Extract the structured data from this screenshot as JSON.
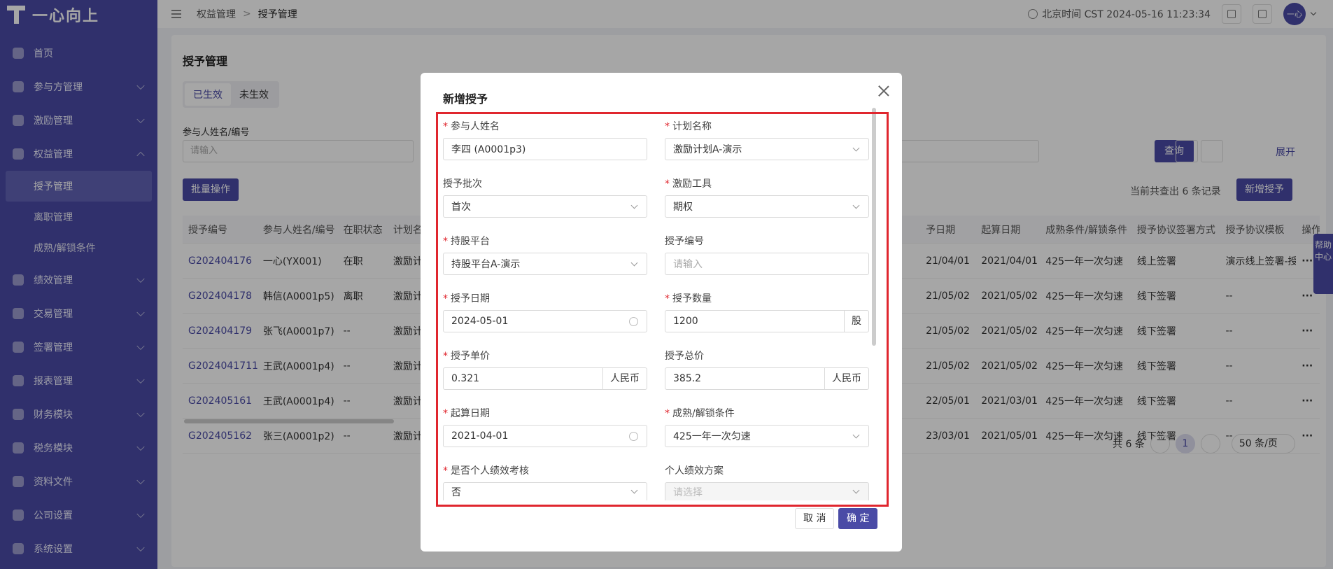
{
  "app": {
    "logo_text": "一心向上"
  },
  "sidebar": {
    "items": [
      {
        "label": "首页",
        "expandable": false
      },
      {
        "label": "参与方管理",
        "expandable": true
      },
      {
        "label": "激励管理",
        "expandable": true
      },
      {
        "label": "权益管理",
        "expandable": true,
        "expanded": true,
        "children": [
          "授予管理",
          "离职管理",
          "成熟/解锁条件"
        ]
      },
      {
        "label": "绩效管理",
        "expandable": true
      },
      {
        "label": "交易管理",
        "expandable": true
      },
      {
        "label": "签署管理",
        "expandable": true
      },
      {
        "label": "报表管理",
        "expandable": true
      },
      {
        "label": "财务模块",
        "expandable": true
      },
      {
        "label": "税务模块",
        "expandable": true
      },
      {
        "label": "资料文件",
        "expandable": true
      },
      {
        "label": "公司设置",
        "expandable": true
      },
      {
        "label": "系统设置",
        "expandable": true
      }
    ],
    "active_child": "授予管理"
  },
  "topbar": {
    "breadcrumb": [
      "权益管理",
      "授予管理"
    ],
    "clock": "北京时间 CST 2024-05-16 11:23:34",
    "avatar": "一心"
  },
  "page": {
    "title": "授予管理",
    "tabs": [
      "已生效",
      "未生效"
    ],
    "filter_label": "参与人姓名/编号",
    "filter_placeholder": "请输入",
    "query_label": "查询",
    "expand_label": "展开",
    "batch_label": "批量操作",
    "count_text": "当前共查出 6 条记录",
    "add_label": "新增授予",
    "table": {
      "headers": [
        "授予编号",
        "参与人姓名/编号",
        "在职状态",
        "计划名",
        "",
        "",
        "",
        "",
        "",
        "",
        "予日期",
        "起算日期",
        "成熟条件/解锁条件",
        "授予协议签署方式",
        "授予协议模板",
        "操作"
      ],
      "rows": [
        [
          "G202404176",
          "一心(YX001)",
          "在职",
          "激励计",
          "21/04/01",
          "2021/04/01",
          "425一年一次匀速",
          "线上签署",
          "演示线上签署-授予"
        ],
        [
          "G202404178",
          "韩信(A0001p5)",
          "离职",
          "激励计",
          "21/05/02",
          "2021/05/02",
          "425一年一次匀速",
          "线下签署",
          "--"
        ],
        [
          "G202404179",
          "张飞(A0001p7)",
          "--",
          "激励计",
          "21/05/02",
          "2021/05/02",
          "425一年一次匀速",
          "线下签署",
          "--"
        ],
        [
          "G2024041711",
          "王武(A0001p4)",
          "--",
          "激励计",
          "21/05/02",
          "2021/05/02",
          "425一年一次匀速",
          "线下签署",
          "--"
        ],
        [
          "G202405161",
          "王武(A0001p4)",
          "--",
          "激励计",
          "22/05/01",
          "2021/03/01",
          "425一年一次匀速",
          "线下签署",
          "--"
        ],
        [
          "G202405162",
          "张三(A0001p2)",
          "--",
          "激励计",
          "23/03/01",
          "2021/05/01",
          "425一年一次匀速",
          "线下签署",
          "--"
        ]
      ]
    },
    "pager": {
      "total": "共 6 条",
      "current": "1",
      "size": "50 条/页"
    },
    "help": "帮助中心"
  },
  "modal": {
    "title": "新增授予",
    "fields": {
      "participant": {
        "label": "参与人姓名",
        "value": "李四 (A0001p3)",
        "required": true
      },
      "plan": {
        "label": "计划名称",
        "value": "激励计划A-演示",
        "required": true
      },
      "batch": {
        "label": "授予批次",
        "value": "首次",
        "required": false
      },
      "tool": {
        "label": "激励工具",
        "value": "期权",
        "required": true
      },
      "platform": {
        "label": "持股平台",
        "value": "持股平台A-演示",
        "required": true
      },
      "grant_no": {
        "label": "授予编号",
        "placeholder": "请输入",
        "required": false
      },
      "grant_date": {
        "label": "授予日期",
        "value": "2024-05-01",
        "required": true
      },
      "quantity": {
        "label": "授予数量",
        "value": "1200",
        "unit": "股",
        "required": true
      },
      "unit_price": {
        "label": "授予单价",
        "value": "0.321",
        "unit": "人民币",
        "required": true
      },
      "total_price": {
        "label": "授予总价",
        "value": "385.2",
        "unit": "人民币",
        "required": false
      },
      "start_date": {
        "label": "起算日期",
        "value": "2021-04-01",
        "required": true
      },
      "vesting": {
        "label": "成熟/解锁条件",
        "value": "425一年一次匀速",
        "required": true
      },
      "perf_check": {
        "label": "是否个人绩效考核",
        "value": "否",
        "required": true
      },
      "perf_plan": {
        "label": "个人绩效方案",
        "placeholder": "请选择",
        "required": false
      }
    },
    "cancel_label": "取 消",
    "ok_label": "确 定"
  },
  "colors": {
    "brand": "#4a4ba6",
    "highlight": "#e0262e"
  }
}
